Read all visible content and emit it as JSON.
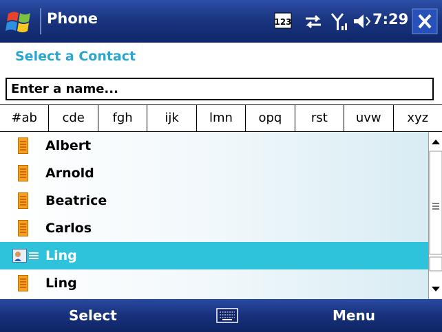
{
  "titlebar": {
    "title": "Phone",
    "status": {
      "input_mode": "123",
      "time": "7:29"
    },
    "icons": [
      "windows-start-icon",
      "input-mode-icon",
      "data-connection-icon",
      "signal-icon",
      "volume-icon",
      "close-icon"
    ]
  },
  "heading": "Select a Contact",
  "search": {
    "placeholder": "Enter a name..."
  },
  "letters": [
    "#ab",
    "cde",
    "fgh",
    "ijk",
    "lmn",
    "opq",
    "rst",
    "uvw",
    "xyz"
  ],
  "contacts": [
    {
      "name": "Albert",
      "selected": false
    },
    {
      "name": "Arnold",
      "selected": false
    },
    {
      "name": "Beatrice",
      "selected": false
    },
    {
      "name": "Carlos",
      "selected": false
    },
    {
      "name": "Ling",
      "selected": true
    },
    {
      "name": "Ling",
      "selected": false
    }
  ],
  "softkeys": {
    "left": "Select",
    "right": "Menu"
  },
  "colors": {
    "titlebar": "#1a3580",
    "heading": "#2ba6cf",
    "selection": "#2ec3da",
    "contact_card": "#f2a21c"
  }
}
